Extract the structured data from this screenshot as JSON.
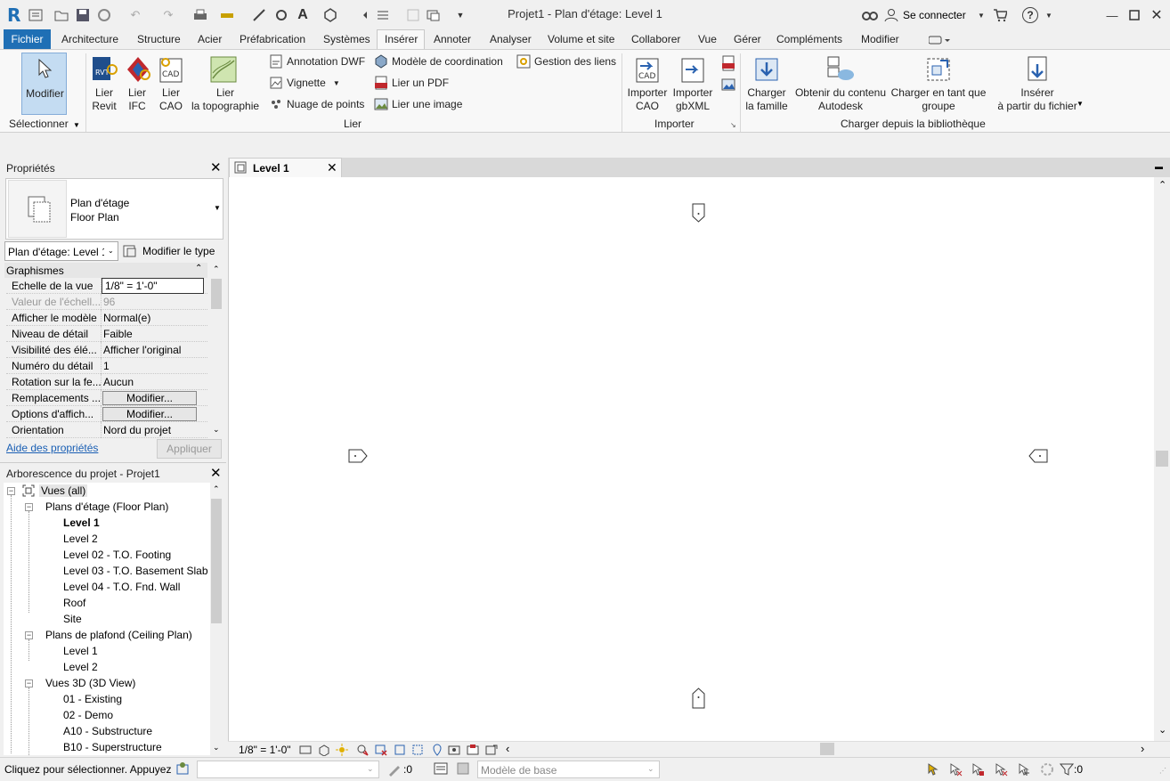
{
  "app": {
    "logo": "R",
    "title": "Projet1 - Plan d'étage: Level 1",
    "sign_in": "Se connecter",
    "help": "?"
  },
  "menu": {
    "items": [
      "Fichier",
      "Architecture",
      "Structure",
      "Acier",
      "Préfabrication",
      "Systèmes",
      "Insérer",
      "Annoter",
      "Analyser",
      "Volume et site",
      "Collaborer",
      "Vue",
      "Gérer",
      "Compléments",
      "Modifier"
    ]
  },
  "ribbon": {
    "modify": {
      "label": "Modifier",
      "panel": "Sélectionner"
    },
    "link": {
      "panel": "Lier",
      "revit_l1": "Lier",
      "revit_l2": "Revit",
      "ifc_l1": "Lier",
      "ifc_l2": "IFC",
      "cad_l1": "Lier",
      "cad_l2": "CAO",
      "topo_l1": "Lier",
      "topo_l2": "la topographie",
      "dwf": "Annotation DWF",
      "decal": "Vignette",
      "pointcloud": "Nuage de points",
      "coord": "Modèle de  coordination",
      "pdf": "Lier un  PDF",
      "image": "Lier une  image",
      "manage": "Gestion des liens"
    },
    "import": {
      "panel": "Importer",
      "cad_l1": "Importer",
      "cad_l2": "CAO",
      "gbxml_l1": "Importer",
      "gbxml_l2": "gbXML"
    },
    "library": {
      "panel": "Charger depuis la bibliothèque",
      "family_l1": "Charger",
      "family_l2": "la famille",
      "autodesk_l1": "Obtenir du contenu",
      "autodesk_l2": "Autodesk",
      "group_l1": "Charger en tant que",
      "group_l2": "groupe",
      "insert_l1": "Insérer",
      "insert_l2": "à partir du fichier"
    }
  },
  "properties": {
    "title": "Propriétés",
    "type_l1": "Plan d'étage",
    "type_l2": "Floor Plan",
    "instance_select": "Plan d'étage: Level 1",
    "edit_type": "Modifier le type",
    "section": "Graphismes",
    "rows": [
      {
        "k": "Echelle de la vue",
        "v": "1/8\" = 1'-0\""
      },
      {
        "k": "Valeur de l'échell...",
        "v": "96"
      },
      {
        "k": "Afficher le modèle",
        "v": "Normal(e)"
      },
      {
        "k": "Niveau de détail",
        "v": "Faible"
      },
      {
        "k": "Visibilité des élé...",
        "v": "Afficher l'original"
      },
      {
        "k": "Numéro du détail",
        "v": "1"
      },
      {
        "k": "Rotation sur la fe...",
        "v": "Aucun"
      },
      {
        "k": "Remplacements ...",
        "v": "Modifier..."
      },
      {
        "k": "Options d'affich...",
        "v": "Modifier..."
      },
      {
        "k": "Orientation",
        "v": "Nord du projet"
      }
    ],
    "help_link": "Aide des propriétés",
    "apply": "Appliquer"
  },
  "browser": {
    "title": "Arborescence du projet - Projet1",
    "root": "Vues (all)",
    "floor_group": "Plans d'étage (Floor Plan)",
    "floor_items": [
      "Level 1",
      "Level 2",
      "Level 02 - T.O. Footing",
      "Level 03 - T.O. Basement Slab",
      "Level 04 - T.O. Fnd. Wall",
      "Roof",
      "Site"
    ],
    "ceiling_group": "Plans de plafond (Ceiling Plan)",
    "ceiling_items": [
      "Level 1",
      "Level 2"
    ],
    "view3d_group": "Vues 3D (3D View)",
    "view3d_items": [
      "01 - Existing",
      "02 - Demo",
      "A10 - Substructure",
      "B10 - Superstructure"
    ]
  },
  "view": {
    "tab": "Level 1",
    "scale": "1/8\" = 1'-0\""
  },
  "status": {
    "hint": "Cliquez pour sélectionner. Appuyez",
    "worksets": ":0",
    "design_option": "Modèle de base",
    "filter_count": ":0"
  }
}
